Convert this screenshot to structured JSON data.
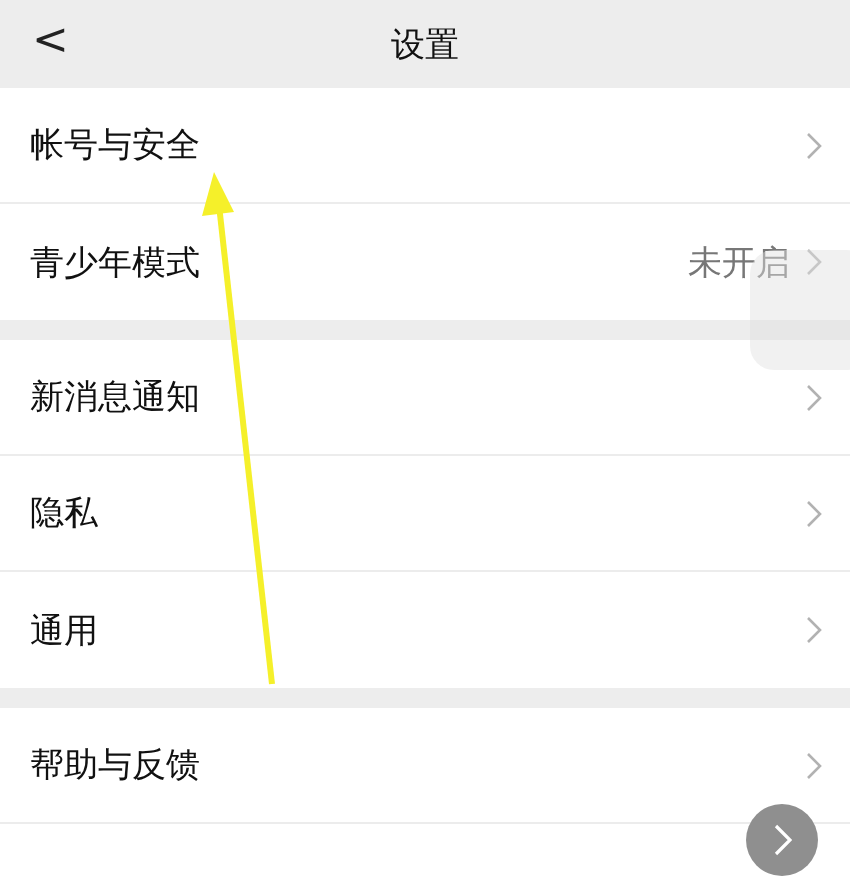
{
  "header": {
    "back": "<",
    "title": "设置"
  },
  "groups": [
    {
      "items": [
        {
          "label": "帐号与安全"
        },
        {
          "label": "青少年模式",
          "value": "未开启"
        }
      ]
    },
    {
      "items": [
        {
          "label": "新消息通知"
        },
        {
          "label": "隐私"
        },
        {
          "label": "通用"
        }
      ]
    },
    {
      "items": [
        {
          "label": "帮助与反馈"
        }
      ]
    }
  ]
}
